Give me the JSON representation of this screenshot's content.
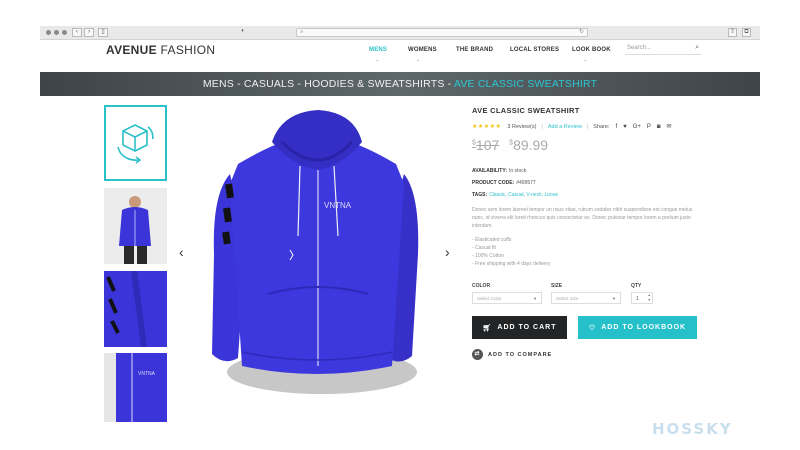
{
  "browser": {
    "back": "‹",
    "forward": "›",
    "sidebar": "▯",
    "address": ""
  },
  "header": {
    "logo_bold": "AVENUE",
    "logo_light": " FASHION",
    "nav": [
      "MENS",
      "WOMENS",
      "THE BRAND",
      "LOCAL STORES",
      "LOOK BOOK"
    ],
    "search_placeholder": "Search"
  },
  "breadcrumb": {
    "path": "MENS - CASUALS - HOODIES & SWEATSHIRTS - ",
    "current": "AVE CLASSIC SWEATSHIRT"
  },
  "gallery": {
    "prev": "‹",
    "next": "›",
    "thumb_icon": "3d-rotate-icon"
  },
  "product": {
    "title": "AVE CLASSIC SWEATSHIRT",
    "stars": "★★★★★",
    "reviews": "3 Review(s)",
    "add_review": "Add a Review",
    "share_label": "Share:",
    "share_icons": [
      "f",
      "♥",
      "G+",
      "P",
      "◙",
      "✉"
    ],
    "price_old": "107",
    "price_new": "89.99",
    "currency": "$",
    "availability_label": "AVAILABILITY:",
    "availability": "In stock",
    "code_label": "PRODUCT CODE:",
    "code": "#499577",
    "tags_label": "TAGS:",
    "tags": "Classic, Casual, V-neck, Loose",
    "description": "Donec sem lorem laoreet tempor un risus vitae, rutrum sodales nibh suspendisse est congue metus nunc, id viverra elit loreit rhoncus quis consectetur es. Donec pulvinar tempor lorem a pretium justo interdum.",
    "features": [
      "Elasticated cuffs",
      "Casual fit",
      "100% Cotton",
      "Free shipping with 4 days delivery"
    ],
    "color_label": "COLOR",
    "color_placeholder": "Select Color",
    "size_label": "SIZE",
    "size_placeholder": "Select Size",
    "qty_label": "QTY",
    "qty_value": "1",
    "cart_button": "ADD TO CART",
    "lookbook_button": "ADD TO LOOKBOOK",
    "compare": "ADD TO COMPARE"
  },
  "colors": {
    "accent": "#2bbfc8",
    "hoodie": "#3b35d9",
    "dark": "#222426"
  },
  "watermark": "HOSSKY"
}
